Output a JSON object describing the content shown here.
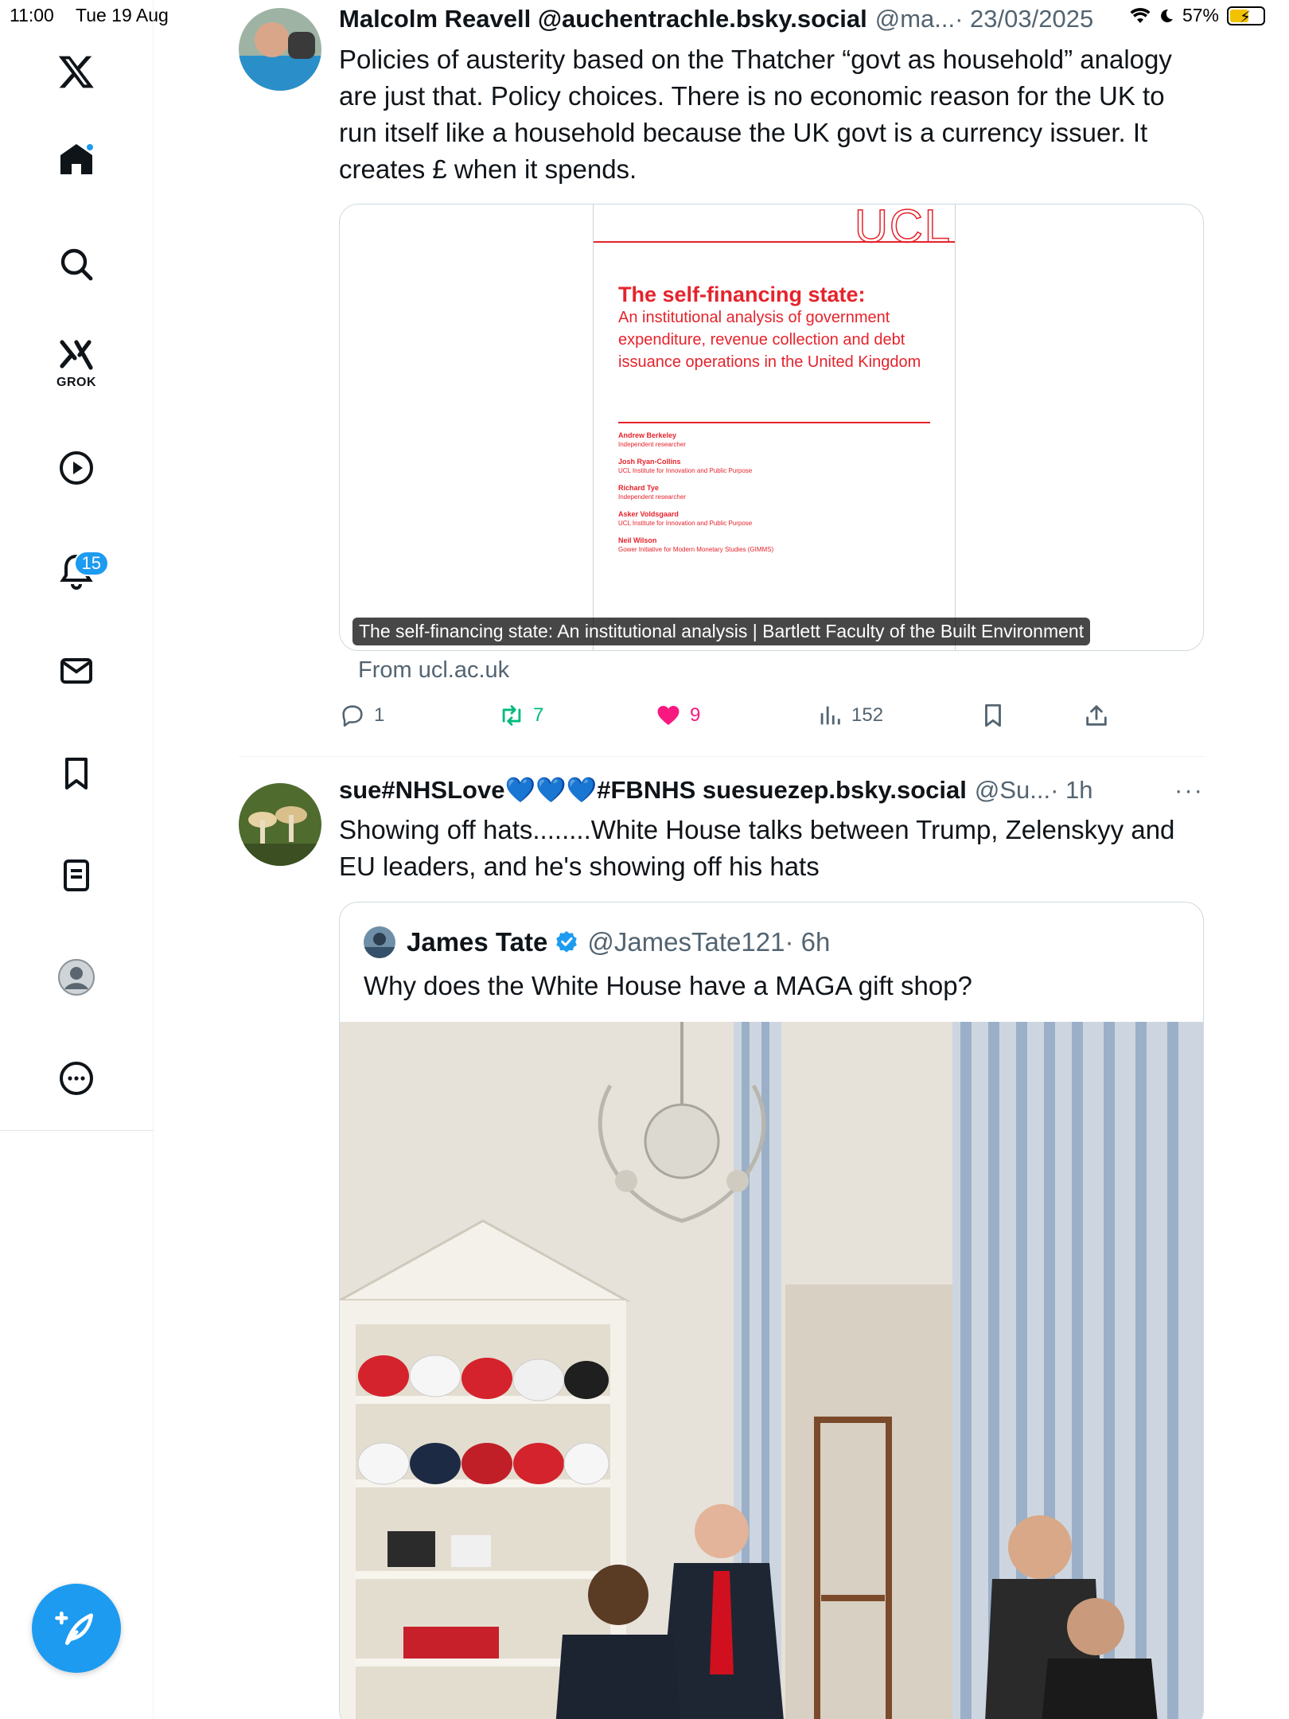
{
  "status_bar": {
    "time": "11:00",
    "date": "Tue 19 Aug",
    "battery": "57%",
    "battery_level": 0.57
  },
  "sidebar": {
    "items": [
      {
        "name": "x-logo",
        "label": ""
      },
      {
        "name": "home",
        "label": ""
      },
      {
        "name": "explore",
        "label": ""
      },
      {
        "name": "grok",
        "label": "GROK"
      },
      {
        "name": "videos",
        "label": ""
      },
      {
        "name": "notifications",
        "label": "",
        "badge": "15"
      },
      {
        "name": "messages",
        "label": ""
      },
      {
        "name": "bookmarks",
        "label": ""
      },
      {
        "name": "lists",
        "label": ""
      },
      {
        "name": "profile",
        "label": ""
      },
      {
        "name": "more",
        "label": ""
      }
    ]
  },
  "posts": [
    {
      "name": "Malcolm Reavell @auchentrachle.bsky.social",
      "handle": "@ma...",
      "time": "· 23/03/2025",
      "text": "Policies of austerity based on the Thatcher “govt as household” analogy are just that. Policy choices. There is no economic reason for the UK to run itself like a household because the UK govt is a currency issuer. It creates £ when it spends.",
      "card": {
        "doc_logo": "UCL",
        "doc_title": "The self-financing state:",
        "doc_subtitle": "An institutional analysis of government expenditure, revenue collection and debt issuance operations in the United Kingdom",
        "authors": [
          {
            "name": "Andrew Berkeley",
            "affil": "Independent researcher"
          },
          {
            "name": "Josh Ryan-Collins",
            "affil": "UCL Institute for Innovation and Public Purpose"
          },
          {
            "name": "Richard Tye",
            "affil": "Independent researcher"
          },
          {
            "name": "Asker Voldsgaard",
            "affil": "UCL Institute for Innovation and Public Purpose"
          },
          {
            "name": "Neil Wilson",
            "affil": "Gower Initiative for Modern Monetary Studies (GIMMS)"
          }
        ],
        "caption": "The self-financing state: An institutional analysis | Bartlett Faculty of the Built Environment",
        "from": "From ucl.ac.uk"
      },
      "actions": {
        "replies": "1",
        "reposts": "7",
        "likes": "9",
        "views": "152"
      }
    },
    {
      "name": "sue#NHSLove💙💙💙#FBNHS suesuezep.bsky.social",
      "handle": "@Su...",
      "time": "· 1h",
      "more": "···",
      "text": "Showing off hats........White House talks between Trump, Zelenskyy and EU leaders, and he's showing off his hats",
      "quote": {
        "name": "James Tate",
        "handle": "@JamesTate121",
        "time": "· 6h",
        "text": "Why does the White House have a MAGA gift shop?"
      }
    }
  ]
}
